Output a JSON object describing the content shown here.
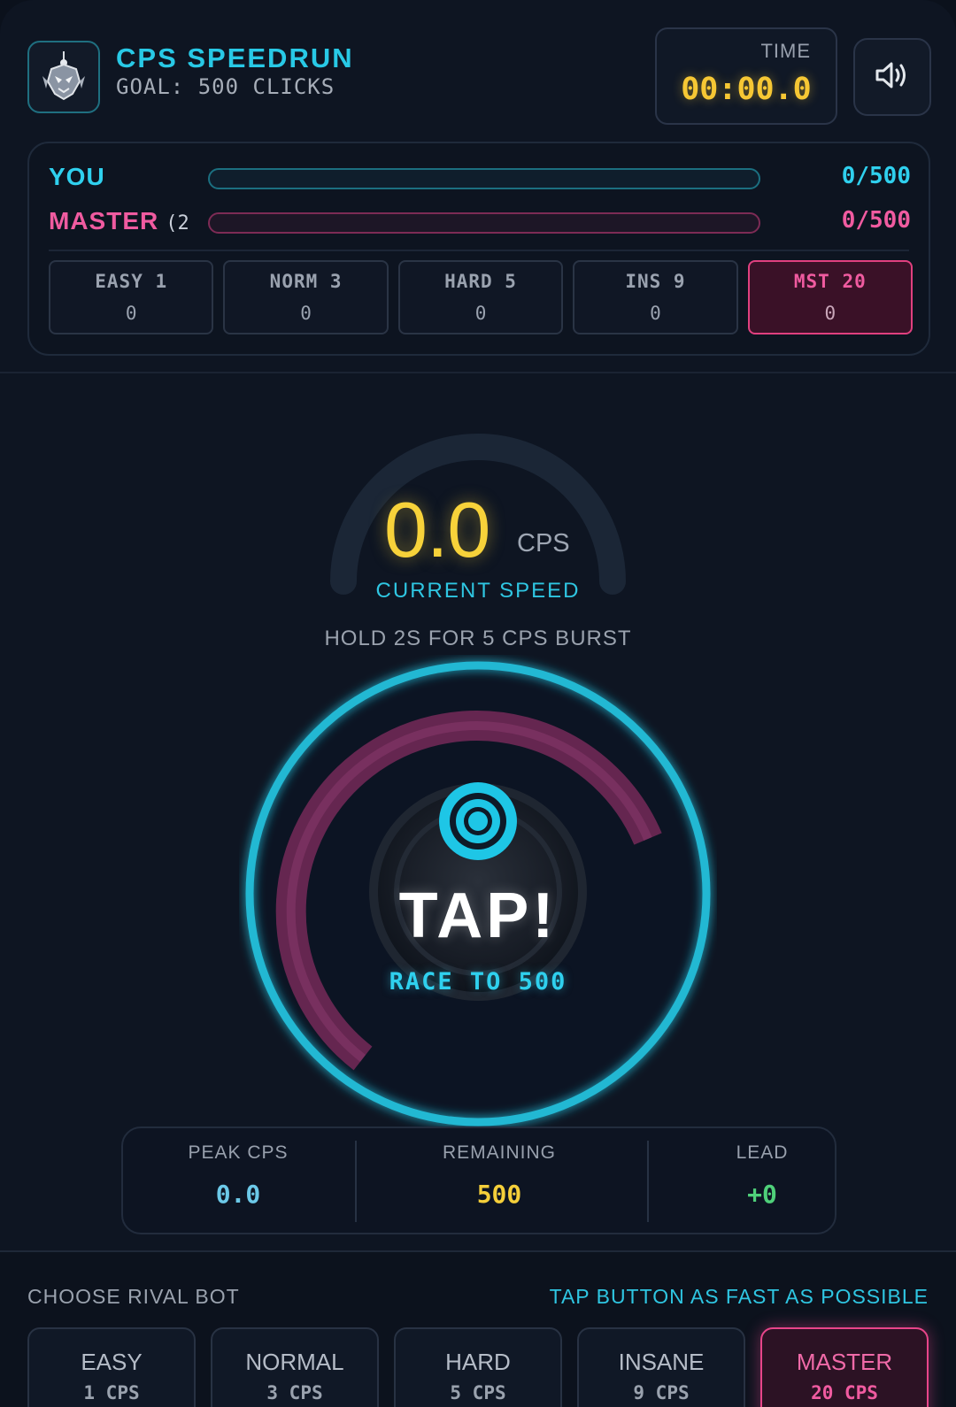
{
  "header": {
    "title": "CPS SPEEDRUN",
    "subtitle": "GOAL: 500 CLICKS",
    "time_label": "TIME",
    "time_value": "00:00.0",
    "logo_icon": "robot-icon",
    "sound_icon": "speaker-icon"
  },
  "race": {
    "you_label": "YOU",
    "you_score": "0/500",
    "you_progress": 0,
    "master_label": "MASTER",
    "master_extra": "(2",
    "master_score": "0/500",
    "master_progress": 0,
    "tiers": [
      {
        "name": "EASY 1",
        "value": "0"
      },
      {
        "name": "NORM 3",
        "value": "0"
      },
      {
        "name": "HARD 5",
        "value": "0"
      },
      {
        "name": "INS 9",
        "value": "0"
      },
      {
        "name": "MST 20",
        "value": "0"
      }
    ]
  },
  "gauge": {
    "value": "0.0",
    "unit": "CPS",
    "label": "CURRENT SPEED"
  },
  "hint": "HOLD 2S FOR 5 CPS BURST",
  "tap": {
    "label": "TAP!",
    "sublabel": "RACE TO 500",
    "icon": "target-icon"
  },
  "stats": {
    "peak_label": "PEAK CPS",
    "peak_value": "0.0",
    "remaining_label": "REMAINING",
    "remaining_value": "500",
    "lead_label": "LEAD",
    "lead_value": "+0"
  },
  "footer": {
    "choose_label": "CHOOSE RIVAL BOT",
    "tap_hint": "TAP BUTTON AS FAST AS POSSIBLE",
    "bots": [
      {
        "name": "EASY",
        "cps": "1 CPS"
      },
      {
        "name": "NORMAL",
        "cps": "3 CPS"
      },
      {
        "name": "HARD",
        "cps": "5 CPS"
      },
      {
        "name": "INSANE",
        "cps": "9 CPS"
      },
      {
        "name": "MASTER",
        "cps": "20 CPS"
      }
    ]
  },
  "colors": {
    "accent_cyan": "#2fd0ee",
    "accent_pink": "#f05ba0",
    "time_yellow": "#f6c734",
    "lead_green": "#4fd07a"
  }
}
